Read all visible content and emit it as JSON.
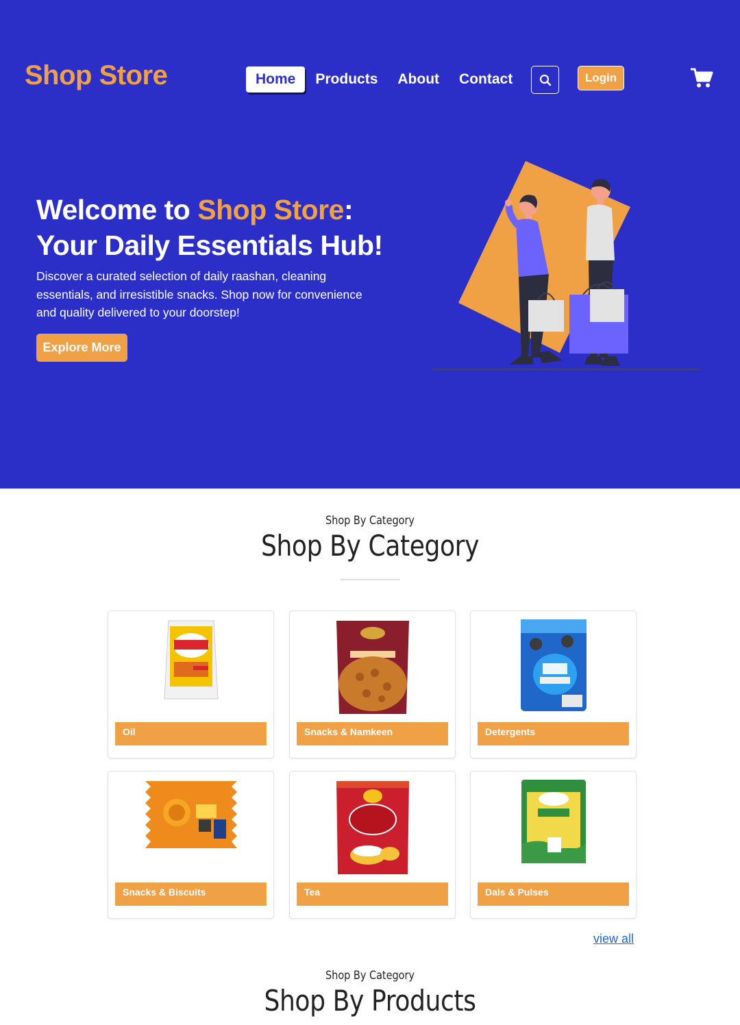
{
  "brand": {
    "name": "Shop Store"
  },
  "nav": {
    "items": [
      {
        "label": "Home",
        "active": true
      },
      {
        "label": "Products",
        "active": false
      },
      {
        "label": "About",
        "active": false
      },
      {
        "label": "Contact",
        "active": false
      }
    ],
    "search_icon": "search-icon",
    "login_label": "Login",
    "cart_icon": "cart-icon"
  },
  "hero": {
    "title_prefix": "Welcome to ",
    "title_brand": "Shop Store",
    "title_colon": ":",
    "title_line2": "Your Daily Essentials Hub!",
    "description": "Discover a curated selection of daily raashan, cleaning essentials, and irresistible snacks. Shop now for convenience and quality delivered to your doorstep!",
    "cta_label": "Explore More"
  },
  "categories_section": {
    "kicker": "Shop By Category",
    "title": "Shop By Category",
    "items": [
      {
        "label": "Oil"
      },
      {
        "label": "Snacks & Namkeen"
      },
      {
        "label": "Detergents"
      },
      {
        "label": "Snacks & Biscuits"
      },
      {
        "label": "Tea"
      },
      {
        "label": "Dals & Pulses"
      }
    ],
    "view_all": "view all"
  },
  "products_section": {
    "kicker": "Shop By Category",
    "title": "Shop By Products"
  },
  "colors": {
    "primary": "#2b2fc7",
    "accent": "#f0a045",
    "link": "#2466c7"
  }
}
